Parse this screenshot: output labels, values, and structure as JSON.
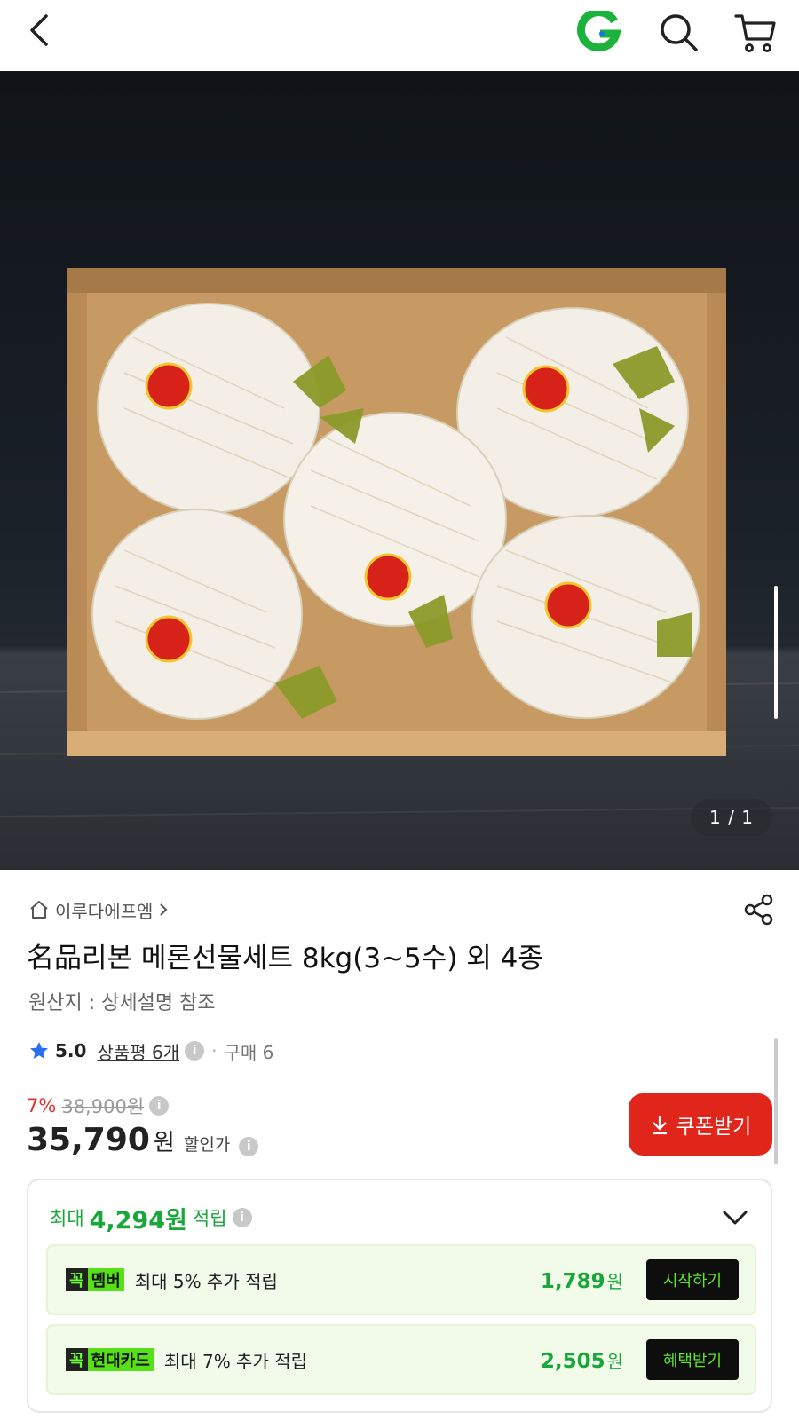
{
  "header": {
    "back_icon": "chevron-left-icon",
    "logo_icon": "g-logo-icon",
    "search_icon": "search-icon",
    "cart_icon": "cart-icon",
    "logo_color": "#1bb33c"
  },
  "hero": {
    "counter": "1 / 1"
  },
  "product": {
    "shop_name": "이루다에프엠",
    "title": "名品리본 메론선물세트 8kg(3~5수) 외 4종",
    "origin": "원산지 : 상세설명 참조",
    "rating": "5.0",
    "review_label": "상품평 6개",
    "purchase_count": "구매 6",
    "discount_rate": "7%",
    "original_price": "38,900",
    "original_unit": "원",
    "sale_price": "35,790",
    "sale_unit": "원",
    "sale_label": "할인가",
    "coupon_button": "쿠폰받기"
  },
  "points": {
    "prefix": "최대",
    "amount": "4,294원",
    "suffix": "적립",
    "benefits": [
      {
        "badge_mark": "꼭",
        "badge_name": "멤버",
        "text": "최대 5% 추가 적립",
        "amount": "1,789",
        "unit": "원",
        "button": "시작하기"
      },
      {
        "badge_mark": "꼭",
        "badge_name": "현대카드",
        "text": "최대 7% 추가 적립",
        "amount": "2,505",
        "unit": "원",
        "button": "혜택받기"
      }
    ]
  },
  "colors": {
    "accent_red": "#e0251b",
    "accent_green": "#18a83a",
    "badge_green": "#55e01a"
  }
}
